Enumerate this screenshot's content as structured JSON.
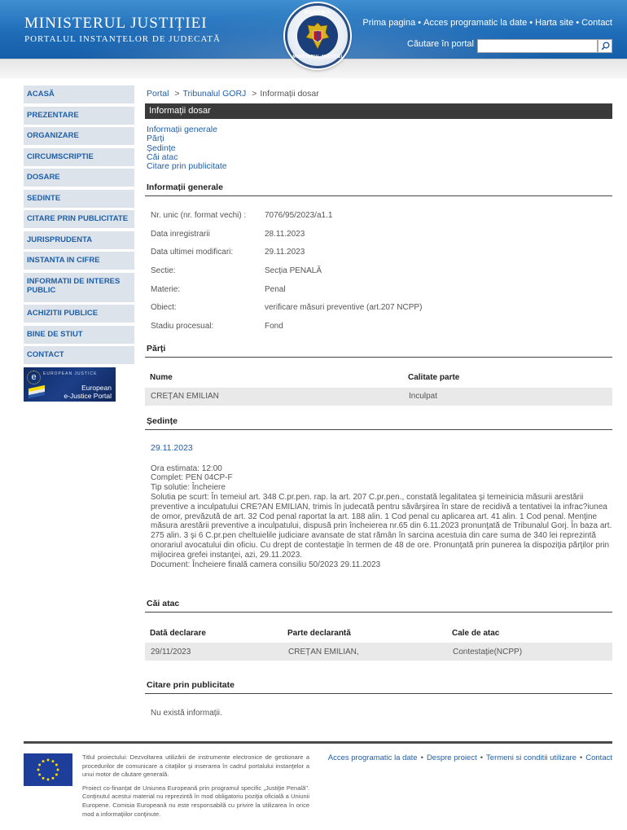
{
  "header": {
    "title": "MINISTERUL JUSTIȚIEI",
    "subtitle": "PORTALUL INSTANȚELOR DE JUDECATĂ",
    "crest_top": "ROMÂNIA",
    "crest_bottom": "MINISTERUL JUSTIȚIEI",
    "nav": [
      "Prima pagina",
      "Acces programatic la date",
      "Harta site",
      "Contact"
    ],
    "search_label": "Căutare în portal",
    "search_value": ""
  },
  "sidebar": {
    "items": [
      {
        "label": "ACASĂ"
      },
      {
        "label": "PREZENTARE"
      },
      {
        "label": "ORGANIZARE"
      },
      {
        "label": "CIRCUMSCRIPTIE"
      },
      {
        "label": "DOSARE"
      },
      {
        "label": "SEDINTE"
      },
      {
        "label": "CITARE PRIN PUBLICITATE"
      },
      {
        "label": "JURISPRUDENTA"
      },
      {
        "label": "INSTANTA IN CIFRE"
      },
      {
        "label": "INFORMATII DE INTERES PUBLIC"
      },
      {
        "label": "ACHIZITII PUBLICE"
      },
      {
        "label": "BINE DE STIUT"
      },
      {
        "label": "CONTACT"
      }
    ],
    "ejustice": {
      "small": "EUROPEAN JUSTICE",
      "line1": "European",
      "line2": "e-Justice Portal"
    }
  },
  "breadcrumb": {
    "items": [
      "Portal",
      "Tribunalul GORJ",
      "Informații dosar"
    ]
  },
  "info_bar": "Informații dosar",
  "anchors": [
    "Informații generale",
    "Părți",
    "Ședințe",
    "Căi atac",
    "Citare prin publicitate"
  ],
  "general": {
    "title": "Informații generale",
    "rows": [
      {
        "label": "Nr. unic (nr. format vechi) :",
        "value": "7076/95/2023/a1.1"
      },
      {
        "label": "Data inregistrarii",
        "value": "28.11.2023"
      },
      {
        "label": "Data ultimei modificari:",
        "value": "29.11.2023"
      },
      {
        "label": "Sectie:",
        "value": "Secția PENALĂ"
      },
      {
        "label": "Materie:",
        "value": "Penal"
      },
      {
        "label": "Obiect:",
        "value": "verificare măsuri preventive (art.207 NCPP)"
      },
      {
        "label": "Stadiu procesual:",
        "value": "Fond"
      }
    ]
  },
  "parti": {
    "title": "Părți",
    "headers": [
      "Nume",
      "Calitate parte"
    ],
    "rows": [
      {
        "nume": "CREȚAN EMILIAN",
        "calitate": "Inculpat"
      }
    ]
  },
  "sedinte": {
    "title": "Ședințe",
    "date": "29.11.2023",
    "ora": "Ora estimata: 12:00",
    "complet": "Complet: PEN 04CP-F",
    "tip": "Tip solutie: Încheiere",
    "solutie": "Solutia pe scurt: În temeiul art. 348 C.pr.pen. rap. la art. 207 C.pr.pen., constată legalitatea şi temeinicia măsurii arestării preventive a inculpatului CRE?AN EMILIAN, trimis în judecată pentru săvârşirea în stare de recidivă a tentativei la infrac?iunea de omor, prevăzută de art. 32 Cod penal raportat la art. 188 alin. 1 Cod penal cu aplicarea art. 41 alin. 1 Cod penal. Menţine măsura arestării preventive a inculpatului, dispusă prin încheierea nr.65 din 6.11.2023 pronunţată de Tribunalul Gorj. În baza art. 275 alin. 3 şi 6 C.pr.pen cheltuielile judiciare avansate de stat rămân în sarcina acestuia din care suma de 340 lei reprezintă onorariul avocatului din oficiu. Cu drept de contestaţie în termen de 48 de ore. Pronunţată prin punerea la dispoziţia părţilor prin mijlocirea grefei instanţei, azi, 29.11.2023.",
    "document": "Document: Încheiere finală camera consiliu  50/2023  29.11.2023"
  },
  "cai_atac": {
    "title": "Căi atac",
    "headers": [
      "Dată declarare",
      "Parte declarantă",
      "Cale de atac"
    ],
    "rows": [
      {
        "data": "29/11/2023",
        "parte": "CREȚAN EMILIAN,",
        "cale": "Contestație(NCPP)"
      }
    ]
  },
  "citare": {
    "title": "Citare prin publicitate",
    "empty": "Nu există informații."
  },
  "footer": {
    "para1": "Titlul proiectului: Dezvoltarea utilizării de instrumente electronice de gestionare a procedurilor de comunicare a citaţiilor şi inserarea în cadrul portalului instanţelor a unui motor de căutare generală.",
    "para2": "Proiect co-finanţat de Uniunea Europeană prin programul specific „Justiţie Penală\". Conţinutul acestui material nu reprezintă în mod obligatoriu poziţia oficială a Uniunii Europene. Comisia Europeană nu este responsabilă cu privire la utilizarea în orice mod a informaţiilor conţinute.",
    "links": [
      "Acces programatic la date",
      "Despre proiect",
      "Termeni si conditii utilizare",
      "Contact"
    ]
  },
  "colors": {
    "header_blue": "#1f6cb8",
    "link_blue": "#1f5fa8",
    "sidebar_bg": "#dde3ea",
    "dark_bar": "#3a3a3a"
  }
}
